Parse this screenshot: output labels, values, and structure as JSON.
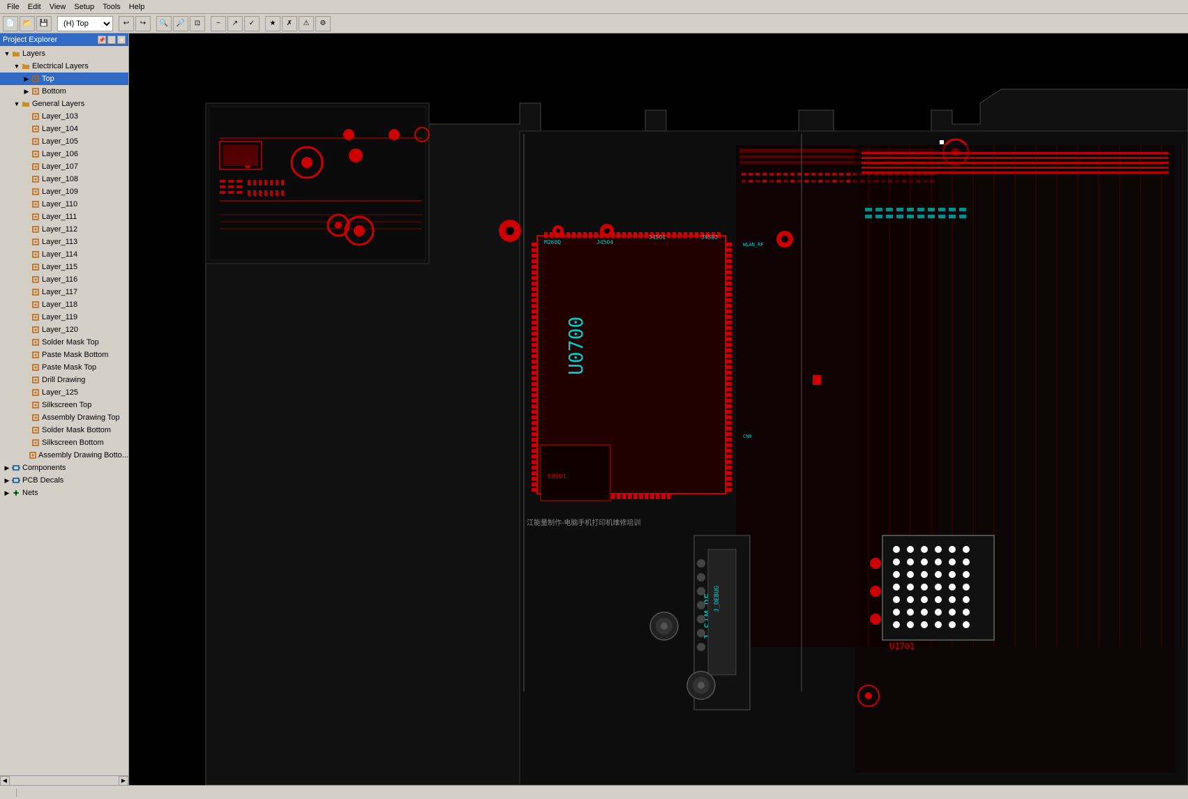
{
  "menu": {
    "items": [
      "File",
      "Edit",
      "View",
      "Setup",
      "Tools",
      "Help"
    ]
  },
  "toolbar": {
    "layer_dropdown": "(H) Top",
    "buttons": [
      "new",
      "open",
      "save",
      "sep",
      "undo",
      "redo",
      "sep",
      "zoom-in",
      "zoom-out",
      "zoom-fit",
      "sep",
      "route",
      "interactive",
      "sep",
      "drc"
    ]
  },
  "sidebar": {
    "title": "Project Explorer",
    "header_buttons": [
      "-",
      "x"
    ],
    "tree": [
      {
        "id": "layers",
        "label": "Layers",
        "indent": 0,
        "expand": true,
        "icon": "folder"
      },
      {
        "id": "electrical",
        "label": "Electrical Layers",
        "indent": 1,
        "expand": true,
        "icon": "folder"
      },
      {
        "id": "top",
        "label": "Top",
        "indent": 2,
        "expand": false,
        "icon": "layer",
        "selected": true
      },
      {
        "id": "bottom",
        "label": "Bottom",
        "indent": 2,
        "expand": false,
        "icon": "layer"
      },
      {
        "id": "general",
        "label": "General Layers",
        "indent": 1,
        "expand": true,
        "icon": "folder"
      },
      {
        "id": "l103",
        "label": "Layer_103",
        "indent": 2,
        "icon": "layer"
      },
      {
        "id": "l104",
        "label": "Layer_104",
        "indent": 2,
        "icon": "layer"
      },
      {
        "id": "l105",
        "label": "Layer_105",
        "indent": 2,
        "icon": "layer"
      },
      {
        "id": "l106",
        "label": "Layer_106",
        "indent": 2,
        "icon": "layer"
      },
      {
        "id": "l107",
        "label": "Layer_107",
        "indent": 2,
        "icon": "layer"
      },
      {
        "id": "l108",
        "label": "Layer_108",
        "indent": 2,
        "icon": "layer"
      },
      {
        "id": "l109",
        "label": "Layer_109",
        "indent": 2,
        "icon": "layer"
      },
      {
        "id": "l110",
        "label": "Layer_110",
        "indent": 2,
        "icon": "layer"
      },
      {
        "id": "l111",
        "label": "Layer_111",
        "indent": 2,
        "icon": "layer"
      },
      {
        "id": "l112",
        "label": "Layer_112",
        "indent": 2,
        "icon": "layer"
      },
      {
        "id": "l113",
        "label": "Layer_113",
        "indent": 2,
        "icon": "layer"
      },
      {
        "id": "l114",
        "label": "Layer_114",
        "indent": 2,
        "icon": "layer"
      },
      {
        "id": "l115",
        "label": "Layer_115",
        "indent": 2,
        "icon": "layer"
      },
      {
        "id": "l116",
        "label": "Layer_116",
        "indent": 2,
        "icon": "layer"
      },
      {
        "id": "l117",
        "label": "Layer_117",
        "indent": 2,
        "icon": "layer"
      },
      {
        "id": "l118",
        "label": "Layer_118",
        "indent": 2,
        "icon": "layer"
      },
      {
        "id": "l119",
        "label": "Layer_119",
        "indent": 2,
        "icon": "layer"
      },
      {
        "id": "l120",
        "label": "Layer_120",
        "indent": 2,
        "icon": "layer"
      },
      {
        "id": "smtop",
        "label": "Solder Mask Top",
        "indent": 2,
        "icon": "layer"
      },
      {
        "id": "pmbot",
        "label": "Paste Mask Bottom",
        "indent": 2,
        "icon": "layer"
      },
      {
        "id": "pmtop",
        "label": "Paste Mask Top",
        "indent": 2,
        "icon": "layer"
      },
      {
        "id": "drill",
        "label": "Drill Drawing",
        "indent": 2,
        "icon": "layer"
      },
      {
        "id": "l125",
        "label": "Layer_125",
        "indent": 2,
        "icon": "layer"
      },
      {
        "id": "sstop",
        "label": "Silkscreen Top",
        "indent": 2,
        "icon": "layer"
      },
      {
        "id": "adtop",
        "label": "Assembly Drawing Top",
        "indent": 2,
        "icon": "layer"
      },
      {
        "id": "smbot",
        "label": "Solder Mask Bottom",
        "indent": 2,
        "icon": "layer"
      },
      {
        "id": "ssbot",
        "label": "Silkscreen Bottom",
        "indent": 2,
        "icon": "layer"
      },
      {
        "id": "adbot",
        "label": "Assembly Drawing Botto...",
        "indent": 2,
        "icon": "layer"
      },
      {
        "id": "components",
        "label": "Components",
        "indent": 0,
        "expand": false,
        "icon": "component"
      },
      {
        "id": "pcbdecals",
        "label": "PCB Decals",
        "indent": 0,
        "expand": false,
        "icon": "component"
      },
      {
        "id": "nets",
        "label": "Nets",
        "indent": 0,
        "expand": false,
        "icon": "net"
      }
    ]
  },
  "pcb": {
    "background": "#000000",
    "board_color": "#1a1a1a"
  },
  "status": {
    "items": [
      ""
    ]
  }
}
